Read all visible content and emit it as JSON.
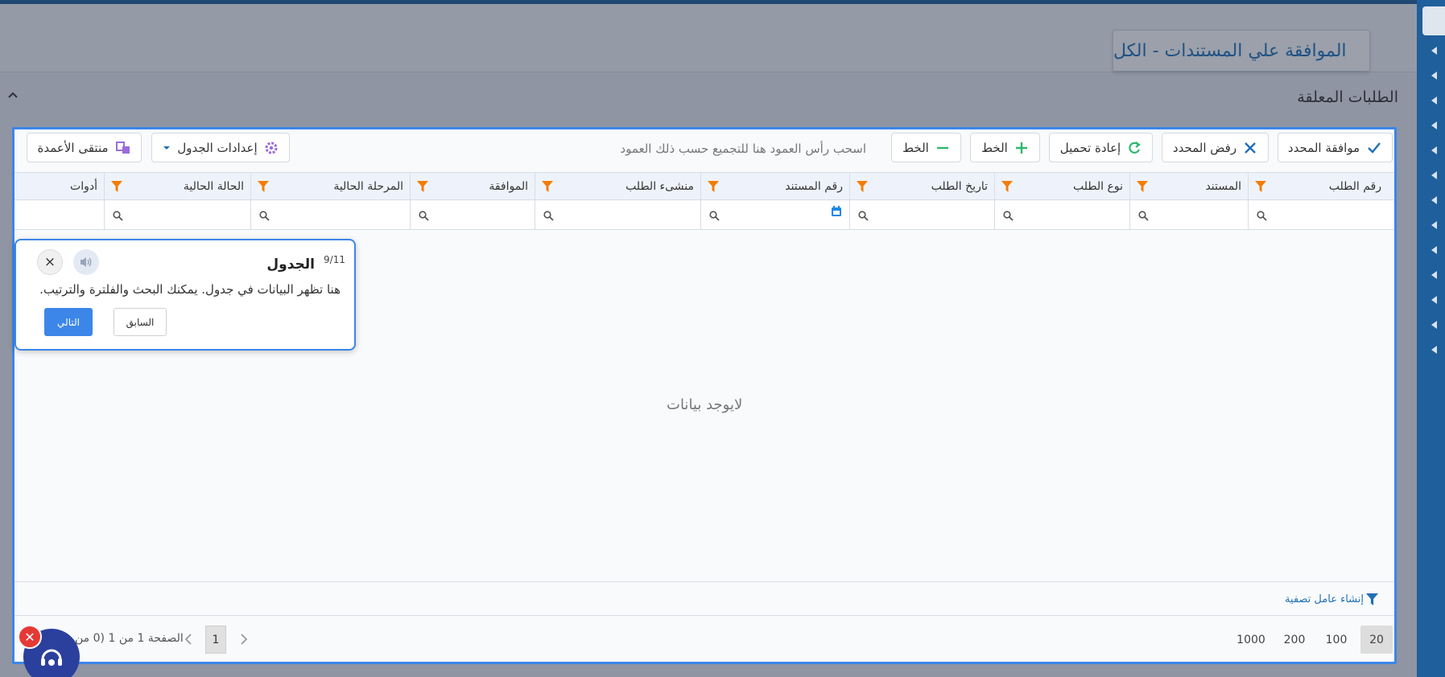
{
  "header": {
    "page_title": "الموافقة علي المستندات - الكل",
    "section_title": "الطلبات المعلقة"
  },
  "toolbar": {
    "approve_selected": "موافقة المحدد",
    "reject_selected": "رفض المحدد",
    "reload": "إعادة تحميل",
    "add_row": "الخط",
    "remove_row": "الخط",
    "group_hint": "اسحب رأس العمود هنا للتجميع حسب ذلك العمود",
    "table_settings": "إعدادات الجدول",
    "column_chooser": "منتقى الأعمدة"
  },
  "table": {
    "columns": [
      "رقم الطلب",
      "المستند",
      "نوع الطلب",
      "تاريخ الطلب",
      "رقم المستند",
      "منشىء الطلب",
      "الموافقة",
      "المرحلة الحالية",
      "الحالة الحالية",
      "أدوات"
    ],
    "empty_message": "لايوجد بيانات"
  },
  "filter_builder": {
    "label": "إنشاء عامل تصفية"
  },
  "pager": {
    "page_sizes": [
      "20",
      "100",
      "200",
      "1000"
    ],
    "selected_page_size": "20",
    "current_page": "1",
    "info_text": "الصفحة 1 من 1 (0 من"
  },
  "tour": {
    "step": "9/11",
    "title": "الجدول",
    "body": "هنا تظهر البيانات في جدول. يمكنك البحث والفلترة والترتيب.",
    "prev_label": "السابق",
    "next_label": "التالي",
    "close_label": "×"
  },
  "colors": {
    "accent": "#3b86e8",
    "brand_dark": "#1f5f9b",
    "filter_orange": "#f57c00",
    "reload_green": "#2eb86b",
    "settings_purple": "#9b6cd8"
  }
}
